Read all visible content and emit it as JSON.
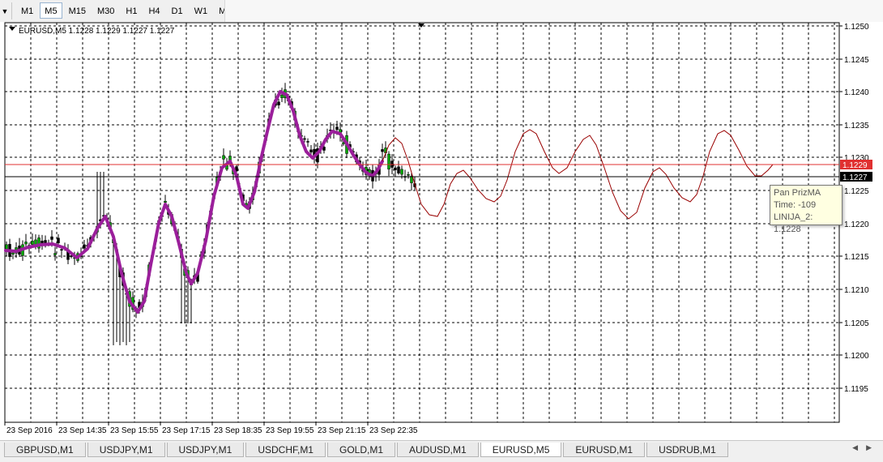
{
  "timeframes": [
    {
      "label": "M1",
      "active": false
    },
    {
      "label": "M5",
      "active": true
    },
    {
      "label": "M15",
      "active": false
    },
    {
      "label": "M30",
      "active": false
    },
    {
      "label": "H1",
      "active": false
    },
    {
      "label": "H4",
      "active": false
    },
    {
      "label": "D1",
      "active": false
    },
    {
      "label": "W1",
      "active": false
    },
    {
      "label": "MN",
      "active": false
    }
  ],
  "chart": {
    "header": "EURUSD,M5  1.1228 1.1229 1.1227 1.1227",
    "price_axis": [
      "1.1250",
      "1.1245",
      "1.1240",
      "1.1235",
      "1.1230",
      "1.1225",
      "1.1220",
      "1.1215",
      "1.1210",
      "1.1205",
      "1.1200",
      "1.1195"
    ],
    "time_axis": [
      "23 Sep 2016",
      "23 Sep 14:35",
      "23 Sep 15:55",
      "23 Sep 17:15",
      "23 Sep 18:35",
      "23 Sep 19:55",
      "23 Sep 21:15",
      "23 Sep 22:35"
    ],
    "ask_label": "1.1229",
    "bid_label": "1.1227",
    "colors": {
      "bull": "#00aa00",
      "bear": "#000000",
      "ma": "#9b1f9b",
      "projection": "#990000",
      "ask_line": "#e03030",
      "grid": "#000000"
    }
  },
  "tooltip": {
    "name": "Pan PrizMA",
    "time": "Time: -109",
    "value": "LINIJA_2: 1.1228"
  },
  "tabs": [
    {
      "label": "GBPUSD,M1",
      "active": false
    },
    {
      "label": "USDJPY,M1",
      "active": false
    },
    {
      "label": "USDJPY,M1",
      "active": false
    },
    {
      "label": "USDCHF,M1",
      "active": false
    },
    {
      "label": "GOLD,M1",
      "active": false
    },
    {
      "label": "AUDUSD,M1",
      "active": false
    },
    {
      "label": "EURUSD,M5",
      "active": true
    },
    {
      "label": "EURUSD,M1",
      "active": false
    },
    {
      "label": "USDRUB,M1",
      "active": false
    }
  ]
}
